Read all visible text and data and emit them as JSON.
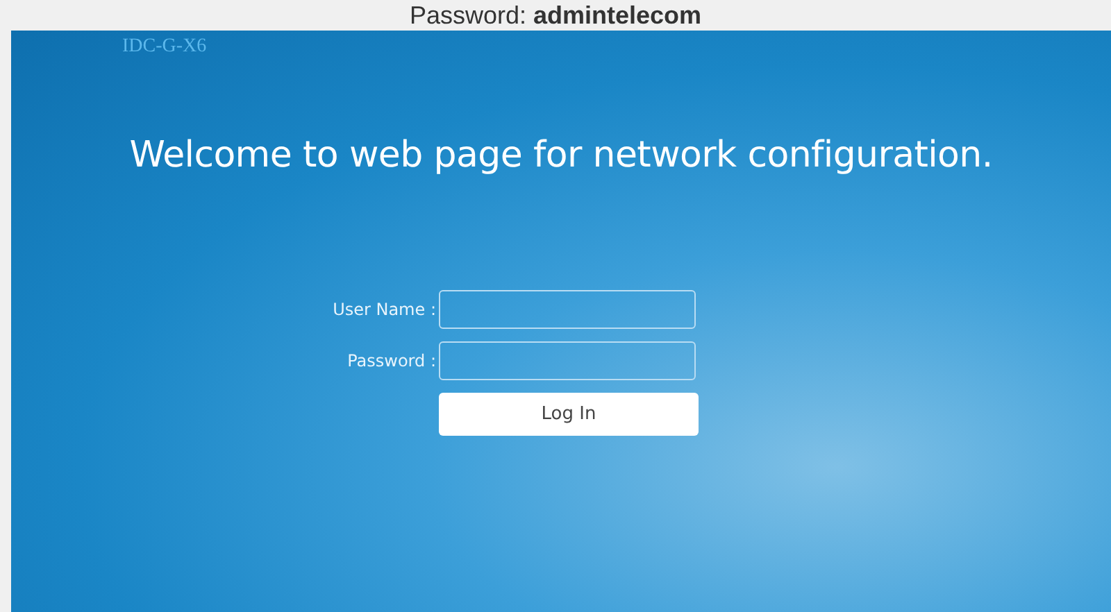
{
  "caption": "Password: **admintelecom**",
  "device_model": "IDC-G-X6",
  "welcome": "Welcome to web page for network configuration.",
  "fields": [
    {
      "label": "User Name :"
    },
    {
      "label": "Password :"
    }
  ],
  "login_button": "Log In"
}
